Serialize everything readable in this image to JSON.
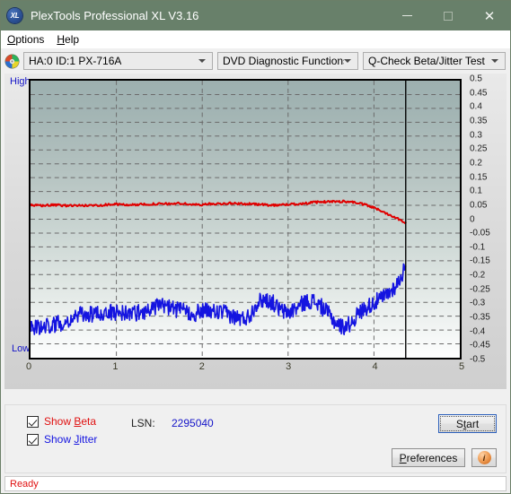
{
  "window": {
    "title": "PlexTools Professional XL V3.16",
    "app_icon": "xl-disc-icon",
    "icon_text": "XL",
    "minimize_label": "Minimize",
    "maximize_label": "Maximize",
    "close_label": "Close",
    "titlebar_color": "#68806a"
  },
  "menu": {
    "items": [
      {
        "label": "Options",
        "accel": "O"
      },
      {
        "label": "Help",
        "accel": "H"
      }
    ]
  },
  "toolbar": {
    "drive_icon": "optical-disc-icon",
    "drive_select": {
      "value": "HA:0 ID:1  PX-716A",
      "options": [
        "HA:0 ID:1  PX-716A"
      ]
    },
    "function_select": {
      "value": "DVD Diagnostic Functions",
      "options": [
        "DVD Diagnostic Functions"
      ]
    },
    "test_select": {
      "value": "Q-Check Beta/Jitter Test",
      "options": [
        "Q-Check Beta/Jitter Test"
      ]
    }
  },
  "chart_panel": {
    "high_label": "High",
    "low_label": "Low"
  },
  "controls": {
    "show_beta": {
      "label_prefix": "Show ",
      "label_accel": "B",
      "label_suffix": "eta",
      "checked": true,
      "color": "#e01010"
    },
    "show_jitter": {
      "label_prefix": "Show ",
      "label_accel": "J",
      "label_suffix": "itter",
      "checked": true,
      "color": "#1414e0"
    },
    "lsn_label": "LSN:",
    "lsn_value": "2295040",
    "start_button": {
      "prefix": "S",
      "accel": "t",
      "suffix": "art",
      "label": "Start"
    },
    "preferences_button": {
      "accel": "P",
      "suffix": "references",
      "label": "Preferences"
    },
    "info_button": {
      "icon": "info-icon",
      "glyph": "i"
    }
  },
  "statusbar": {
    "text": "Ready"
  },
  "chart_data": {
    "type": "line",
    "title": "Q-Check Beta/Jitter Test",
    "xlabel": "",
    "ylabel": "",
    "xlim": [
      0,
      5
    ],
    "ylim": [
      -0.5,
      0.5
    ],
    "grid": true,
    "legend_position": "bottom-left",
    "x_ticks": [
      "0",
      "1",
      "2",
      "3",
      "4",
      "5"
    ],
    "y_ticks": [
      "0.5",
      "0.45",
      "0.4",
      "0.35",
      "0.3",
      "0.25",
      "0.2",
      "0.15",
      "0.1",
      "0.05",
      "0",
      "-0.05",
      "-0.1",
      "-0.15",
      "-0.2",
      "-0.25",
      "-0.3",
      "-0.35",
      "-0.4",
      "-0.45",
      "-0.5"
    ],
    "y_axis_top_label": "High",
    "y_axis_bottom_label": "Low",
    "data_end_x": 4.37,
    "end_marker": {
      "x": 4.37,
      "color": "#000000",
      "label": "end-of-data-marker"
    },
    "series": [
      {
        "name": "Beta",
        "color": "#e00000",
        "x": [
          0.0,
          0.09,
          0.18,
          0.27,
          0.36,
          0.45,
          0.55,
          0.64,
          0.73,
          0.82,
          0.91,
          1.0,
          1.09,
          1.18,
          1.27,
          1.36,
          1.46,
          1.55,
          1.64,
          1.73,
          1.82,
          1.91,
          2.0,
          2.09,
          2.18,
          2.28,
          2.37,
          2.46,
          2.55,
          2.64,
          2.73,
          2.82,
          2.91,
          3.0,
          3.1,
          3.19,
          3.28,
          3.37,
          3.46,
          3.55,
          3.64,
          3.73,
          3.82,
          3.92,
          4.01,
          4.1,
          4.19,
          4.28,
          4.37
        ],
        "values": [
          0.05,
          0.049,
          0.05,
          0.051,
          0.05,
          0.049,
          0.05,
          0.049,
          0.05,
          0.051,
          0.053,
          0.054,
          0.052,
          0.052,
          0.053,
          0.054,
          0.055,
          0.055,
          0.056,
          0.057,
          0.055,
          0.052,
          0.053,
          0.055,
          0.056,
          0.057,
          0.057,
          0.056,
          0.055,
          0.054,
          0.052,
          0.051,
          0.052,
          0.053,
          0.055,
          0.057,
          0.06,
          0.062,
          0.063,
          0.064,
          0.064,
          0.063,
          0.058,
          0.05,
          0.04,
          0.028,
          0.015,
          0.002,
          -0.012
        ]
      },
      {
        "name": "Jitter",
        "color": "#1414e0",
        "x": [
          0.0,
          0.09,
          0.18,
          0.27,
          0.36,
          0.45,
          0.55,
          0.64,
          0.73,
          0.82,
          0.91,
          1.0,
          1.09,
          1.18,
          1.27,
          1.36,
          1.46,
          1.55,
          1.64,
          1.73,
          1.82,
          1.91,
          2.0,
          2.09,
          2.18,
          2.28,
          2.37,
          2.46,
          2.55,
          2.64,
          2.73,
          2.82,
          2.91,
          3.0,
          3.1,
          3.19,
          3.28,
          3.37,
          3.46,
          3.55,
          3.64,
          3.73,
          3.82,
          3.92,
          4.01,
          4.1,
          4.19,
          4.28,
          4.37
        ],
        "values": [
          -0.39,
          -0.392,
          -0.386,
          -0.38,
          -0.374,
          -0.362,
          -0.348,
          -0.342,
          -0.345,
          -0.34,
          -0.337,
          -0.336,
          -0.338,
          -0.34,
          -0.336,
          -0.33,
          -0.316,
          -0.312,
          -0.32,
          -0.33,
          -0.334,
          -0.342,
          -0.33,
          -0.334,
          -0.336,
          -0.34,
          -0.352,
          -0.36,
          -0.35,
          -0.3,
          -0.288,
          -0.3,
          -0.33,
          -0.338,
          -0.32,
          -0.3,
          -0.294,
          -0.31,
          -0.338,
          -0.372,
          -0.39,
          -0.376,
          -0.34,
          -0.316,
          -0.3,
          -0.284,
          -0.262,
          -0.23,
          -0.17
        ]
      }
    ]
  }
}
